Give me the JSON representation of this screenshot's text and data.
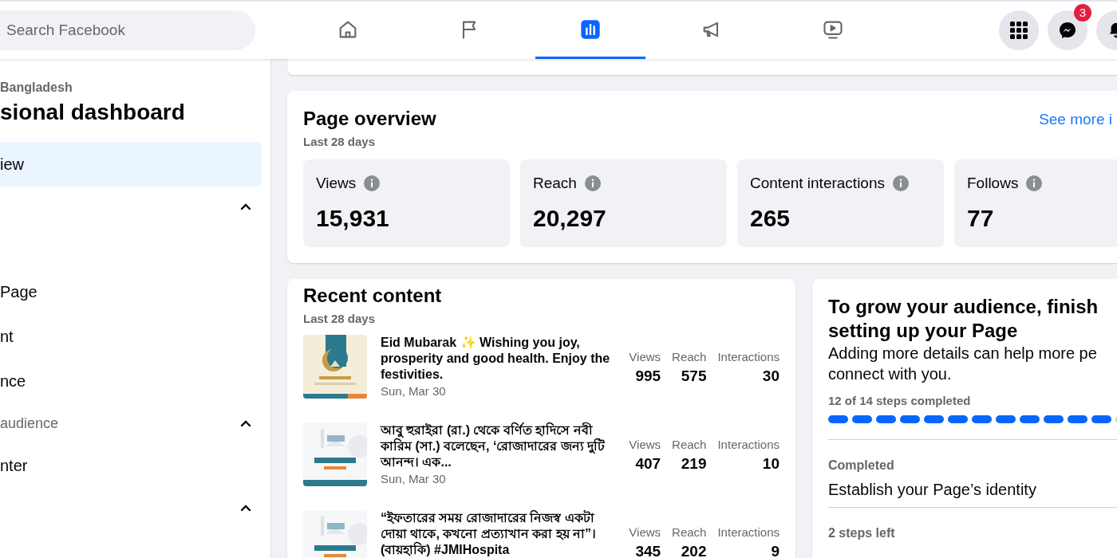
{
  "header": {
    "search": {
      "placeholder": "Search Facebook"
    },
    "tabs": [
      {
        "kind": "home",
        "selected": false
      },
      {
        "kind": "flag",
        "selected": false
      },
      {
        "kind": "insights",
        "selected": true
      },
      {
        "kind": "megaphone",
        "selected": false
      },
      {
        "kind": "video",
        "selected": false
      }
    ],
    "actions": [
      {
        "kind": "grid"
      },
      {
        "kind": "messenger",
        "badge": "3"
      },
      {
        "kind": "bell"
      }
    ]
  },
  "sidebar": {
    "page_name": "Bangladesh",
    "title": "sional dashboard",
    "items": [
      {
        "kind": "item",
        "label": "iew",
        "selected": true
      },
      {
        "kind": "section",
        "expanded": true
      },
      {
        "kind": "spacer"
      },
      {
        "kind": "item",
        "label": "Page",
        "selected": false
      },
      {
        "kind": "item",
        "label": "nt",
        "selected": false
      },
      {
        "kind": "item",
        "label": "nce",
        "selected": false
      },
      {
        "kind": "section",
        "label": "audience",
        "expanded": true
      },
      {
        "kind": "item",
        "label": "nter",
        "selected": false
      },
      {
        "kind": "section",
        "expanded": true
      }
    ]
  },
  "overview": {
    "title": "Page overview",
    "subtitle": "Last 28 days",
    "link": "See more i",
    "metrics": [
      {
        "label": "Views",
        "value": "15,931"
      },
      {
        "label": "Reach",
        "value": "20,297"
      },
      {
        "label": "Content interactions",
        "value": "265"
      },
      {
        "label": "Follows",
        "value": "77"
      }
    ]
  },
  "recent": {
    "title": "Recent content",
    "subtitle": "Last 28 days",
    "posts": [
      {
        "text": "Eid Mubarak ✨ Wishing you joy, prosperity and good health. Enjoy the festivities.",
        "date": "Sun, Mar 30",
        "stats": [
          {
            "label": "Views",
            "value": "995"
          },
          {
            "label": "Reach",
            "value": "575"
          },
          {
            "label": "Interactions",
            "value": "30"
          }
        ]
      },
      {
        "text": "আবু হুরাইরা (রা.) থেকে বর্ণিত হাদিসে নবী কারিম (সা.) বলেছেন, ‘রোজাদারের জন্য দুটি আনন্দ। এক...",
        "date": "Sun, Mar 30",
        "stats": [
          {
            "label": "Views",
            "value": "407"
          },
          {
            "label": "Reach",
            "value": "219"
          },
          {
            "label": "Interactions",
            "value": "10"
          }
        ]
      },
      {
        "text": "“ইফতারের সময় রোজাদারের নিজস্ব একটা দোয়া থাকে, কখনো প্রত্যাখান করা হয় না”। (বায়হাকি) #JMIHospita",
        "stats": [
          {
            "label": "Views",
            "value": "345"
          },
          {
            "label": "Reach",
            "value": "202"
          },
          {
            "label": "Interactions",
            "value": "9"
          }
        ]
      }
    ]
  },
  "setup": {
    "title": "To grow your audience, finish setting up your Page",
    "description": "Adding more details can help more pe connect with you.",
    "progress_label": "12 of 14 steps completed",
    "level": 0.857,
    "groups": [
      {
        "status": "Completed",
        "task": "Establish your Page’s identity"
      },
      {
        "status": "2 steps left"
      }
    ]
  }
}
